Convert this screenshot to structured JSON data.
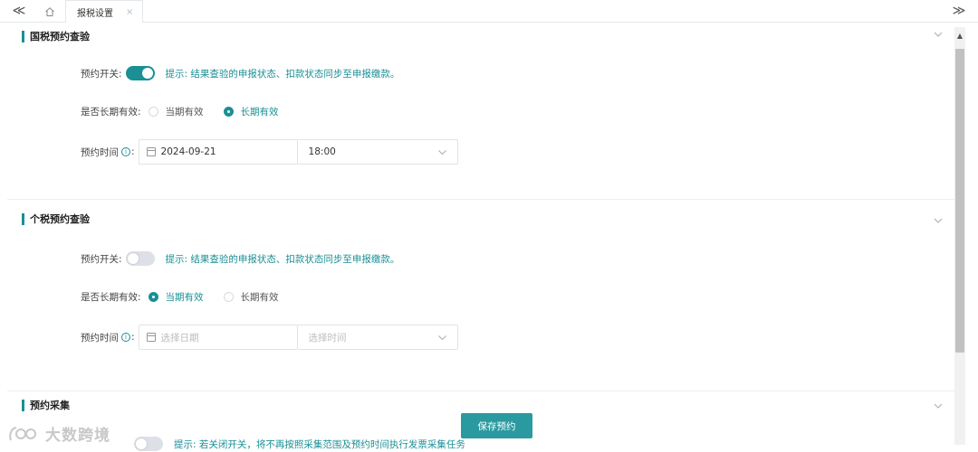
{
  "tabbar": {
    "collapse_glyph": "≪",
    "expand_glyph": "≫",
    "active_tab": "报税设置",
    "close_glyph": "×"
  },
  "sections": {
    "national_tax": {
      "title": "国税预约查验",
      "switch_label": "预约开关:",
      "switch_on": true,
      "hint": "提示: 结果查验的申报状态、扣款状态同步至申报缴款。",
      "long_term_label": "是否长期有效:",
      "radio_current": "当期有效",
      "radio_long": "长期有效",
      "selected": "长期有效",
      "time_label": "预约时间",
      "date_value": "2024-09-21",
      "time_value": "18:00"
    },
    "personal_tax": {
      "title": "个税预约查验",
      "switch_label": "预约开关:",
      "switch_on": false,
      "hint": "提示: 结果查验的申报状态、扣款状态同步至申报缴款。",
      "long_term_label": "是否长期有效:",
      "radio_current": "当期有效",
      "radio_long": "长期有效",
      "selected": "当期有效",
      "time_label": "预约时间",
      "date_placeholder": "选择日期",
      "time_placeholder": "选择时间"
    },
    "collection": {
      "title": "预约采集",
      "partial_hint": "提示: 若关闭开关，将不再按照采集范围及预约时间执行发票采集任务"
    }
  },
  "save_button": "保存预约",
  "watermark": "大数跨境",
  "colors": {
    "accent": "#1a8f95",
    "button": "#2a9aa0"
  }
}
